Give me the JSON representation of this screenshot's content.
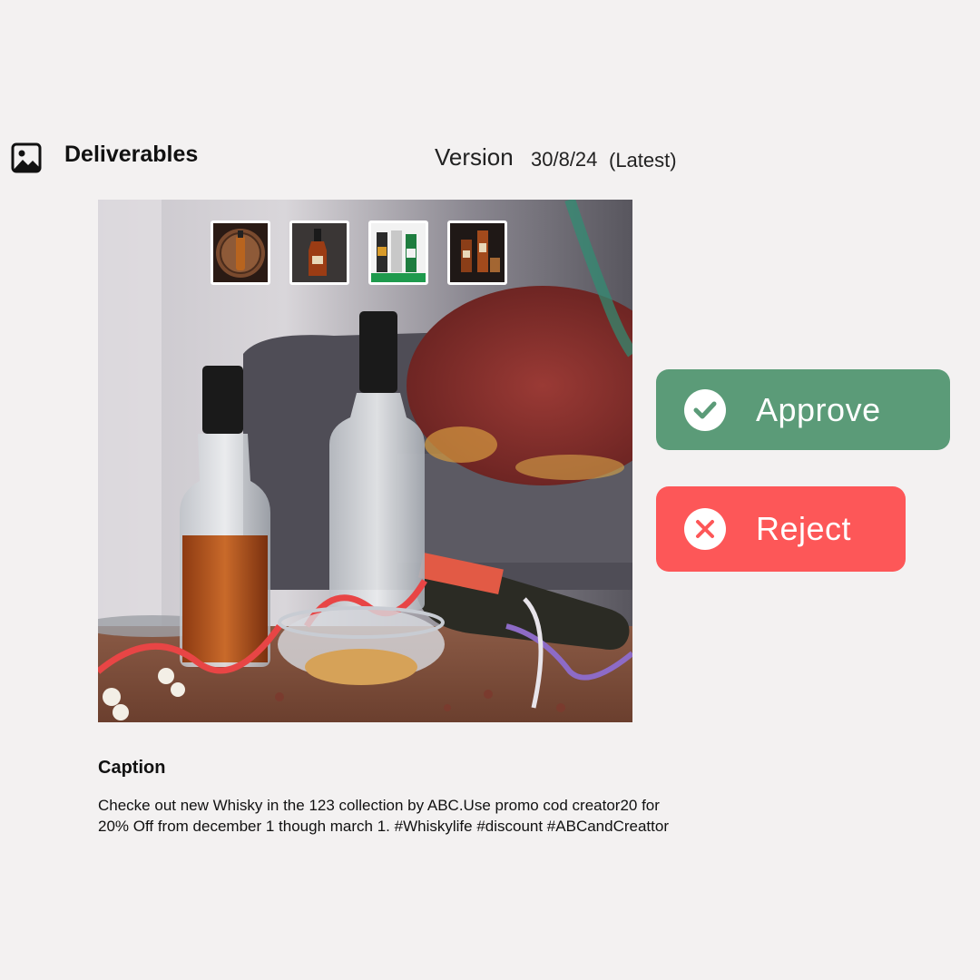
{
  "header": {
    "title": "Deliverables",
    "icon": "image-icon",
    "version_label": "Version",
    "version_date": "30/8/24",
    "version_tag": "(Latest)"
  },
  "preview": {
    "thumbnails": [
      {
        "icon": "whisky-barrel-thumbnail"
      },
      {
        "icon": "whisky-bottle-thumbnail"
      },
      {
        "icon": "liquor-bottles-thumbnail"
      },
      {
        "icon": "whisky-bottles-glass-thumbnail"
      }
    ]
  },
  "actions": {
    "approve": {
      "label": "Approve",
      "icon": "check-circle-icon",
      "color": "#5b9b78"
    },
    "reject": {
      "label": "Reject",
      "icon": "x-circle-icon",
      "color": "#fd5758"
    }
  },
  "caption": {
    "title": "Caption",
    "text": "Checke out new Whisky in the 123  collection by ABC.Use promo cod creator20  for\n20% Off  from december 1 though march 1. #Whiskylife #discount #ABCandCreattor"
  }
}
